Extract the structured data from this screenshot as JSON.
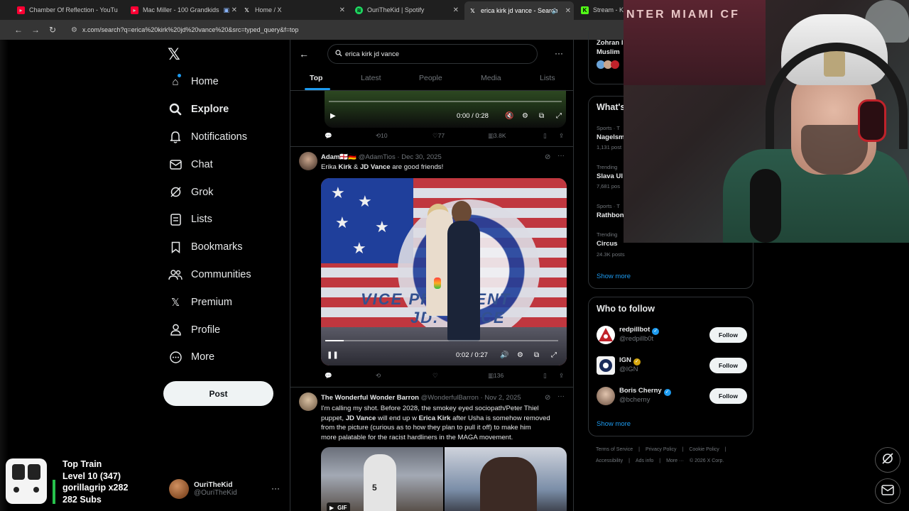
{
  "browser": {
    "tabs": [
      {
        "label": "Chamber Of Reflection - YouTu",
        "icon": "youtube-icon",
        "color": "#ff0033"
      },
      {
        "label": "Mac Miller - 100 Grandkids",
        "icon": "youtube-icon",
        "color": "#ff0033"
      },
      {
        "label": "Home / X",
        "icon": "x-logo-icon",
        "color": "#ffffff"
      },
      {
        "label": "OuriTheKid | Spotify",
        "icon": "spotify-icon",
        "color": "#1ed760"
      },
      {
        "label": "erica kirk jd vance - Search",
        "icon": "x-logo-icon",
        "color": "#ffffff"
      },
      {
        "label": "Stream - Kic",
        "icon": "kick-icon",
        "color": "#53fc18"
      }
    ],
    "url": "x.com/search?q=erica%20kirk%20jd%20vance%20&src=typed_query&f=top"
  },
  "sidebar": {
    "items": [
      {
        "label": "Home",
        "icon": "home-icon"
      },
      {
        "label": "Explore",
        "icon": "search-icon"
      },
      {
        "label": "Notifications",
        "icon": "bell-icon"
      },
      {
        "label": "Chat",
        "icon": "mail-icon"
      },
      {
        "label": "Grok",
        "icon": "grok-icon"
      },
      {
        "label": "Lists",
        "icon": "list-icon"
      },
      {
        "label": "Bookmarks",
        "icon": "bookmark-icon"
      },
      {
        "label": "Communities",
        "icon": "people-icon"
      },
      {
        "label": "Premium",
        "icon": "x-logo-icon"
      },
      {
        "label": "Profile",
        "icon": "person-icon"
      },
      {
        "label": "More",
        "icon": "more-circle-icon"
      }
    ],
    "post_label": "Post",
    "account": {
      "name": "OuriTheKid",
      "handle": "@OuriTheKid"
    }
  },
  "overlay": {
    "line1": "Top Train",
    "line2": "Level 10  (347)",
    "line3": "gorillagrip x282",
    "line4": "282 Subs"
  },
  "search": {
    "query": "erica kirk jd vance",
    "tabs": [
      "Top",
      "Latest",
      "People",
      "Media",
      "Lists"
    ],
    "active_tab": "Top"
  },
  "feed": {
    "video1": {
      "time": "0:00 / 0:28",
      "replies": "",
      "reposts": "10",
      "likes": "77",
      "views": "3.8K"
    },
    "tweet2": {
      "name": "Adam🏴󠁧󠁢󠁥󠁮󠁧󠁿🇩🇪",
      "handle": "@AdamTios",
      "date": "Dec 30, 2025",
      "text_a": "Erika ",
      "text_b": "Kirk",
      "text_c": " & ",
      "text_d": "JD Vance",
      "text_e": " are good friends!",
      "video_text1": "VICE PRESIDENT",
      "video_text2": "JD. VANCE",
      "time": "0:02 / 0:27",
      "progress": 0.08,
      "views": "136"
    },
    "tweet3": {
      "name": "The Wonderful Wonder Barron",
      "handle": "@WonderfulBarron",
      "date": "Nov 2, 2025",
      "text_1": "I'm calling my shot. Before 2028, the smokey eyed sociopath/Peter Thiel",
      "text_2a": "puppet, ",
      "text_2b": "JD Vance",
      "text_2c": " will end up w ",
      "text_2d": "Erica Kirk",
      "text_2e": " after Usha is somehow removed",
      "text_3": "from the picture (curious as to how they plan to pull it off) to make him",
      "text_4": "more palatable for the racist hardliners in the MAGA movement.",
      "gif_label": "GIF",
      "jersey": "5"
    }
  },
  "right": {
    "top_name_1": "Zohran I",
    "top_name_2": "Muslim",
    "whats_happening": "What's",
    "trends": [
      {
        "category": "Sports · T",
        "name": "Nagelsm",
        "count": "1,131 post"
      },
      {
        "category": "Trending",
        "name": "Slava Ul",
        "count": "7,681 pos"
      },
      {
        "category": "Sports · T",
        "name": "Rathbon",
        "count": ""
      },
      {
        "category": "Trending",
        "name": "Circus",
        "count": "24.3K posts"
      }
    ],
    "show_more": "Show more",
    "who_to_follow": "Who to follow",
    "follow": [
      {
        "name": "redpillbot",
        "handle": "@redpillb0t",
        "verified": "blue"
      },
      {
        "name": "IGN",
        "handle": "@IGN",
        "verified": "gold"
      },
      {
        "name": "Boris Cherny",
        "handle": "@bcherny",
        "verified": "blue"
      }
    ],
    "follow_label": "Follow",
    "show_more_2": "Show more",
    "footer": [
      "Terms of Service",
      "|",
      "Privacy Policy",
      "|",
      "Cookie Policy",
      "|",
      "Accessibility",
      "|",
      "Ads info",
      "|",
      "More ···",
      "© 2026 X Corp."
    ]
  },
  "webcam": {
    "banner": "NTER MIAMI CF"
  },
  "colors": {
    "accent": "#1d9bf0",
    "bg": "#000000",
    "border": "#2f3336",
    "muted": "#71767b"
  }
}
